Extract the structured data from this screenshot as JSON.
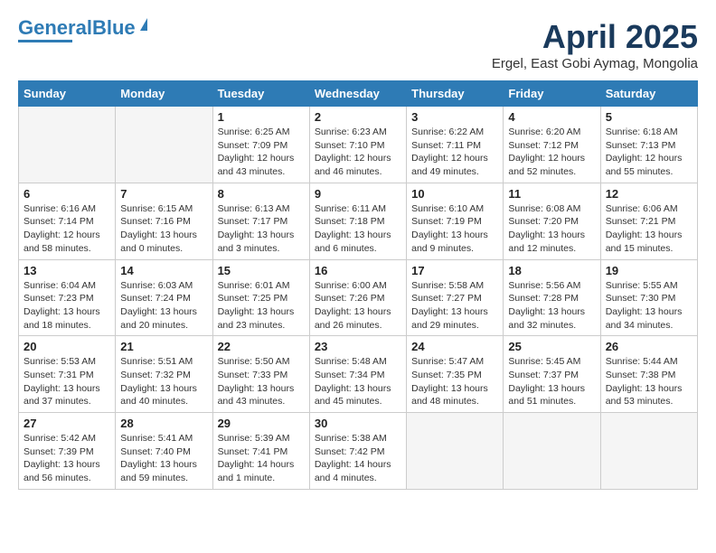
{
  "header": {
    "logo_general": "General",
    "logo_blue": "Blue",
    "title": "April 2025",
    "subtitle": "Ergel, East Gobi Aymag, Mongolia"
  },
  "weekdays": [
    "Sunday",
    "Monday",
    "Tuesday",
    "Wednesday",
    "Thursday",
    "Friday",
    "Saturday"
  ],
  "weeks": [
    [
      {
        "day": "",
        "info": ""
      },
      {
        "day": "",
        "info": ""
      },
      {
        "day": "1",
        "info": "Sunrise: 6:25 AM\nSunset: 7:09 PM\nDaylight: 12 hours\nand 43 minutes."
      },
      {
        "day": "2",
        "info": "Sunrise: 6:23 AM\nSunset: 7:10 PM\nDaylight: 12 hours\nand 46 minutes."
      },
      {
        "day": "3",
        "info": "Sunrise: 6:22 AM\nSunset: 7:11 PM\nDaylight: 12 hours\nand 49 minutes."
      },
      {
        "day": "4",
        "info": "Sunrise: 6:20 AM\nSunset: 7:12 PM\nDaylight: 12 hours\nand 52 minutes."
      },
      {
        "day": "5",
        "info": "Sunrise: 6:18 AM\nSunset: 7:13 PM\nDaylight: 12 hours\nand 55 minutes."
      }
    ],
    [
      {
        "day": "6",
        "info": "Sunrise: 6:16 AM\nSunset: 7:14 PM\nDaylight: 12 hours\nand 58 minutes."
      },
      {
        "day": "7",
        "info": "Sunrise: 6:15 AM\nSunset: 7:16 PM\nDaylight: 13 hours\nand 0 minutes."
      },
      {
        "day": "8",
        "info": "Sunrise: 6:13 AM\nSunset: 7:17 PM\nDaylight: 13 hours\nand 3 minutes."
      },
      {
        "day": "9",
        "info": "Sunrise: 6:11 AM\nSunset: 7:18 PM\nDaylight: 13 hours\nand 6 minutes."
      },
      {
        "day": "10",
        "info": "Sunrise: 6:10 AM\nSunset: 7:19 PM\nDaylight: 13 hours\nand 9 minutes."
      },
      {
        "day": "11",
        "info": "Sunrise: 6:08 AM\nSunset: 7:20 PM\nDaylight: 13 hours\nand 12 minutes."
      },
      {
        "day": "12",
        "info": "Sunrise: 6:06 AM\nSunset: 7:21 PM\nDaylight: 13 hours\nand 15 minutes."
      }
    ],
    [
      {
        "day": "13",
        "info": "Sunrise: 6:04 AM\nSunset: 7:23 PM\nDaylight: 13 hours\nand 18 minutes."
      },
      {
        "day": "14",
        "info": "Sunrise: 6:03 AM\nSunset: 7:24 PM\nDaylight: 13 hours\nand 20 minutes."
      },
      {
        "day": "15",
        "info": "Sunrise: 6:01 AM\nSunset: 7:25 PM\nDaylight: 13 hours\nand 23 minutes."
      },
      {
        "day": "16",
        "info": "Sunrise: 6:00 AM\nSunset: 7:26 PM\nDaylight: 13 hours\nand 26 minutes."
      },
      {
        "day": "17",
        "info": "Sunrise: 5:58 AM\nSunset: 7:27 PM\nDaylight: 13 hours\nand 29 minutes."
      },
      {
        "day": "18",
        "info": "Sunrise: 5:56 AM\nSunset: 7:28 PM\nDaylight: 13 hours\nand 32 minutes."
      },
      {
        "day": "19",
        "info": "Sunrise: 5:55 AM\nSunset: 7:30 PM\nDaylight: 13 hours\nand 34 minutes."
      }
    ],
    [
      {
        "day": "20",
        "info": "Sunrise: 5:53 AM\nSunset: 7:31 PM\nDaylight: 13 hours\nand 37 minutes."
      },
      {
        "day": "21",
        "info": "Sunrise: 5:51 AM\nSunset: 7:32 PM\nDaylight: 13 hours\nand 40 minutes."
      },
      {
        "day": "22",
        "info": "Sunrise: 5:50 AM\nSunset: 7:33 PM\nDaylight: 13 hours\nand 43 minutes."
      },
      {
        "day": "23",
        "info": "Sunrise: 5:48 AM\nSunset: 7:34 PM\nDaylight: 13 hours\nand 45 minutes."
      },
      {
        "day": "24",
        "info": "Sunrise: 5:47 AM\nSunset: 7:35 PM\nDaylight: 13 hours\nand 48 minutes."
      },
      {
        "day": "25",
        "info": "Sunrise: 5:45 AM\nSunset: 7:37 PM\nDaylight: 13 hours\nand 51 minutes."
      },
      {
        "day": "26",
        "info": "Sunrise: 5:44 AM\nSunset: 7:38 PM\nDaylight: 13 hours\nand 53 minutes."
      }
    ],
    [
      {
        "day": "27",
        "info": "Sunrise: 5:42 AM\nSunset: 7:39 PM\nDaylight: 13 hours\nand 56 minutes."
      },
      {
        "day": "28",
        "info": "Sunrise: 5:41 AM\nSunset: 7:40 PM\nDaylight: 13 hours\nand 59 minutes."
      },
      {
        "day": "29",
        "info": "Sunrise: 5:39 AM\nSunset: 7:41 PM\nDaylight: 14 hours\nand 1 minute."
      },
      {
        "day": "30",
        "info": "Sunrise: 5:38 AM\nSunset: 7:42 PM\nDaylight: 14 hours\nand 4 minutes."
      },
      {
        "day": "",
        "info": ""
      },
      {
        "day": "",
        "info": ""
      },
      {
        "day": "",
        "info": ""
      }
    ]
  ]
}
